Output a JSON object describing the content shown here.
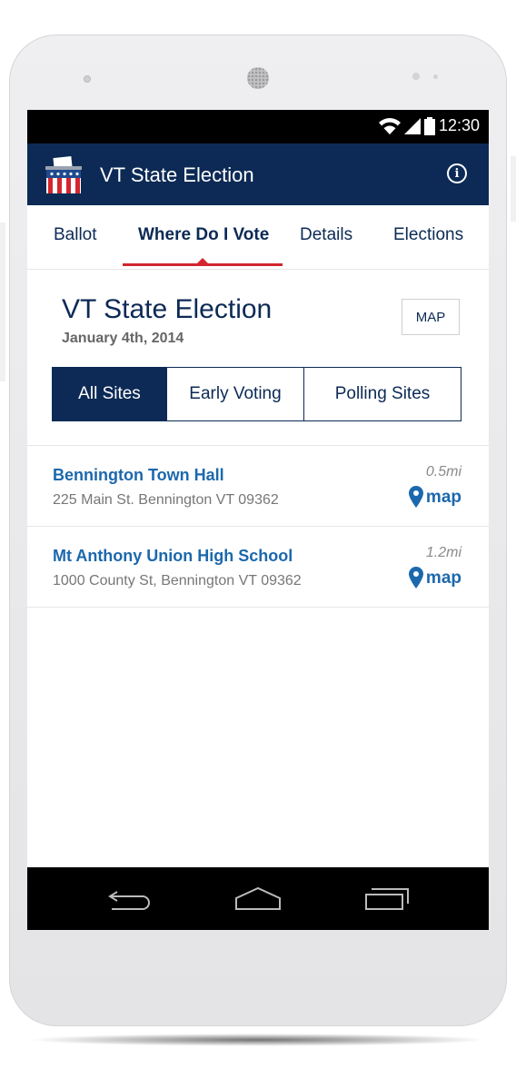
{
  "status_bar": {
    "time": "12:30",
    "icons": [
      "wifi-icon",
      "signal-icon",
      "battery-icon"
    ]
  },
  "app_bar": {
    "title": "VT State Election",
    "logo": "ballot-box-logo",
    "info_icon": "info-icon"
  },
  "tabs": [
    {
      "label": "Ballot",
      "active": false
    },
    {
      "label": "Where Do I Vote",
      "active": true
    },
    {
      "label": "Details",
      "active": false
    },
    {
      "label": "Elections",
      "active": false
    }
  ],
  "election": {
    "title": "VT State Election",
    "date": "January 4th, 2014",
    "map_button": "MAP"
  },
  "filter": {
    "options": [
      "All Sites",
      "Early Voting",
      "Polling Sites"
    ],
    "selected": "All Sites"
  },
  "sites": [
    {
      "name": "Bennington Town Hall",
      "address": "225 Main St. Bennington VT 09362",
      "distance": "0.5mi",
      "map_label": "map"
    },
    {
      "name": "Mt Anthony Union High School",
      "address": "1000 County St, Bennington VT 09362",
      "distance": "1.2mi",
      "map_label": "map"
    }
  ],
  "nav_bar": {
    "buttons": [
      "back-icon",
      "home-icon",
      "recents-icon"
    ]
  },
  "colors": {
    "primary": "#0c2a55",
    "accent": "#d3262f",
    "link": "#1c68ad"
  }
}
